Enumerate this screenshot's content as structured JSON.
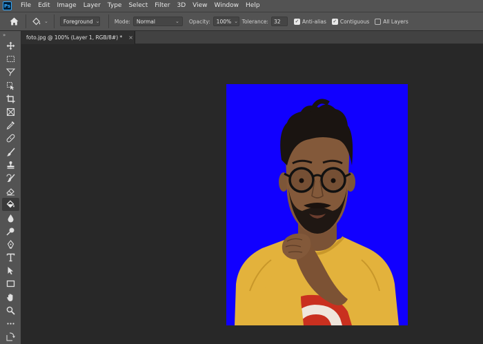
{
  "app": {
    "logo_text": "Ps"
  },
  "menu": {
    "items": [
      "File",
      "Edit",
      "Image",
      "Layer",
      "Type",
      "Select",
      "Filter",
      "3D",
      "View",
      "Window",
      "Help"
    ]
  },
  "options": {
    "fill_source": "Foreground",
    "mode_label": "Mode:",
    "mode_value": "Normal",
    "opacity_label": "Opacity:",
    "opacity_value": "100%",
    "tolerance_label": "Tolerance:",
    "tolerance_value": "32",
    "anti_alias_label": "Anti-alias",
    "anti_alias_checked": true,
    "contiguous_label": "Contiguous",
    "contiguous_checked": true,
    "all_layers_label": "All Layers",
    "all_layers_checked": false
  },
  "document": {
    "tab_title": "foto.jpg @ 100% (Layer 1, RGB/8#) *",
    "tab_close": "×",
    "background_color": "#1100ff"
  },
  "toolbar": {
    "collapse_glyph": "»",
    "tools": [
      "move-tool",
      "marquee-tool",
      "lasso-tool",
      "object-select-tool",
      "crop-tool",
      "frame-tool",
      "eyedropper-tool",
      "healing-brush-tool",
      "brush-tool",
      "clone-stamp-tool",
      "history-brush-tool",
      "eraser-tool",
      "paint-bucket-tool",
      "blur-tool",
      "dodge-tool",
      "pen-tool",
      "type-tool",
      "path-select-tool",
      "rectangle-tool",
      "hand-tool",
      "zoom-tool",
      "more-tools",
      "swap-colors"
    ],
    "active_tool": "paint-bucket-tool"
  }
}
